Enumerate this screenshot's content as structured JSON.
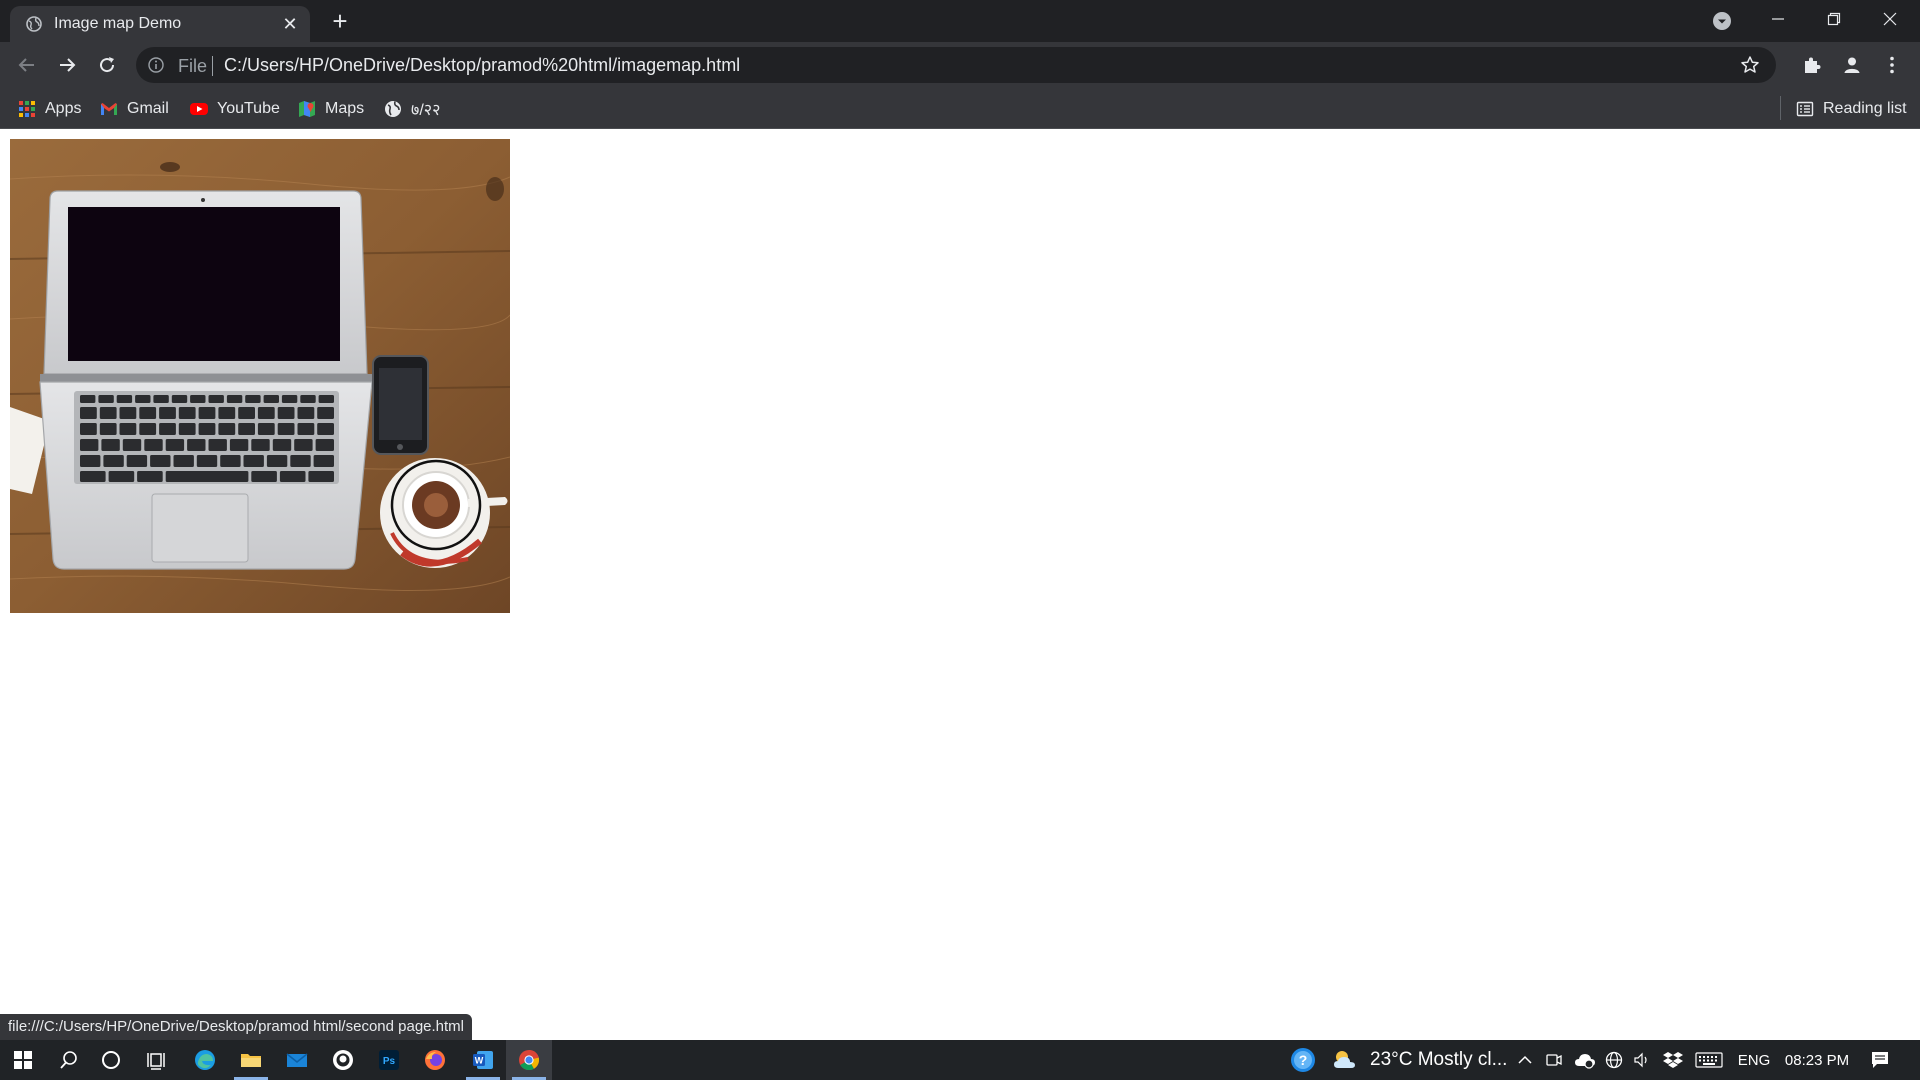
{
  "browser": {
    "tab": {
      "title": "Image map Demo",
      "favicon": "globe-icon",
      "close": "close-icon"
    },
    "new_tab": "+",
    "toolbar": {
      "back": "back-arrow-icon",
      "forward": "forward-arrow-icon",
      "reload": "reload-icon",
      "omnibox": {
        "scheme": "File",
        "url": "C:/Users/HP/OneDrive/Desktop/pramod%20html/imagemap.html"
      },
      "bookmark_star": "star-icon",
      "extensions": "puzzle-icon",
      "profile": "person-icon",
      "menu": "kebab-menu-icon"
    },
    "bookmarks": [
      {
        "label": "Apps",
        "icon": "apps-grid-icon"
      },
      {
        "label": "Gmail",
        "icon": "gmail-icon"
      },
      {
        "label": "YouTube",
        "icon": "youtube-icon"
      },
      {
        "label": "Maps",
        "icon": "maps-icon"
      },
      {
        "label": "७/२२",
        "icon": "globe-icon"
      }
    ],
    "reading_list": {
      "label": "Reading list",
      "icon": "reading-list-icon"
    },
    "status_url": "file:///C:/Users/HP/OneDrive/Desktop/pramod html/second page.html"
  },
  "taskbar": {
    "weather": "23°C  Mostly cl...",
    "language": "ENG",
    "time": "08:23 PM",
    "colors": {
      "accent": "#8bb4e8",
      "background": "#202326"
    }
  }
}
